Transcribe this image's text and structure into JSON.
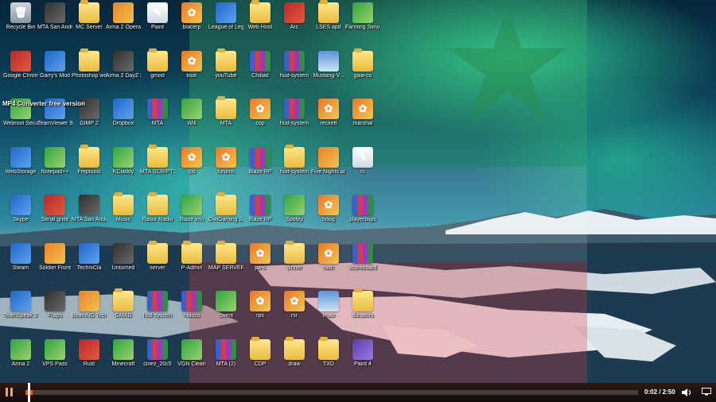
{
  "overlay_caption": "MP4 Converter free version",
  "player": {
    "time": "0:02 / 2:50",
    "progress": 0.012
  },
  "icons": [
    {
      "label": "Recycle Bin",
      "type": "bin",
      "col": 0,
      "row": 0
    },
    {
      "label": "MTA San Andreas 1.3",
      "type": "game",
      "col": 1,
      "row": 0
    },
    {
      "label": "MC Server",
      "type": "folder",
      "col": 2,
      "row": 0
    },
    {
      "label": "Arma 2 Operati...",
      "type": "orange",
      "col": 3,
      "row": 0
    },
    {
      "label": "Paint",
      "type": "doc",
      "col": 4,
      "row": 0
    },
    {
      "label": "blacerp",
      "type": "img",
      "col": 5,
      "row": 0
    },
    {
      "label": "League of Legends",
      "type": "blue",
      "col": 6,
      "row": 0
    },
    {
      "label": "Web Host",
      "type": "folder",
      "col": 7,
      "row": 0
    },
    {
      "label": "Arc",
      "type": "red",
      "col": 8,
      "row": 0
    },
    {
      "label": "LSES apd",
      "type": "folder",
      "col": 9,
      "row": 0
    },
    {
      "label": "Farming Simulator 15",
      "type": "green",
      "col": 10,
      "row": 0
    },
    {
      "label": "Google Chrome",
      "type": "red",
      "col": 0,
      "row": 1
    },
    {
      "label": "Garry's Mod",
      "type": "blue",
      "col": 1,
      "row": 1
    },
    {
      "label": "Photoshop work",
      "type": "folder",
      "col": 2,
      "row": 1
    },
    {
      "label": "Arma 2 DayZ Mod",
      "type": "game",
      "col": 3,
      "row": 1
    },
    {
      "label": "gmod",
      "type": "folder",
      "col": 4,
      "row": 1
    },
    {
      "label": "ksor",
      "type": "img",
      "col": 5,
      "row": 1
    },
    {
      "label": "youTube",
      "type": "folder",
      "col": 6,
      "row": 1
    },
    {
      "label": "Chillad",
      "type": "rar",
      "col": 7,
      "row": 1
    },
    {
      "label": "hud-system",
      "type": "rar",
      "col": 8,
      "row": 1
    },
    {
      "label": "Mustang-V...",
      "type": "photo",
      "col": 9,
      "row": 1
    },
    {
      "label": "gaia-co",
      "type": "folder",
      "col": 10,
      "row": 1
    },
    {
      "label": "Webroot SecureAny...",
      "type": "green",
      "col": 0,
      "row": 2
    },
    {
      "label": "TeamViewer 9",
      "type": "blue",
      "col": 1,
      "row": 2
    },
    {
      "label": "GIMP 2",
      "type": "game",
      "col": 2,
      "row": 2
    },
    {
      "label": "Dropbox",
      "type": "blue",
      "col": 3,
      "row": 2
    },
    {
      "label": "MTA",
      "type": "rar",
      "col": 4,
      "row": 2
    },
    {
      "label": "Will",
      "type": "green",
      "col": 5,
      "row": 2
    },
    {
      "label": "MTA",
      "type": "folder",
      "col": 6,
      "row": 2
    },
    {
      "label": "cop",
      "type": "img",
      "col": 7,
      "row": 2
    },
    {
      "label": "hud-system",
      "type": "rar",
      "col": 8,
      "row": 2
    },
    {
      "label": "reckett",
      "type": "img",
      "col": 9,
      "row": 2
    },
    {
      "label": "marshal",
      "type": "img",
      "col": 10,
      "row": 2
    },
    {
      "label": "WebStorage",
      "type": "blue",
      "col": 0,
      "row": 3
    },
    {
      "label": "Notepad++",
      "type": "green",
      "col": 1,
      "row": 3
    },
    {
      "label": "Freptools",
      "type": "folder",
      "col": 2,
      "row": 3
    },
    {
      "label": "KCladdy",
      "type": "green",
      "col": 3,
      "row": 3
    },
    {
      "label": "MTA SCRIPTS",
      "type": "folder",
      "col": 4,
      "row": 3
    },
    {
      "label": "fpd",
      "type": "img",
      "col": 5,
      "row": 3
    },
    {
      "label": "forums",
      "type": "img",
      "col": 6,
      "row": 3
    },
    {
      "label": "Blaze RP",
      "type": "rar",
      "col": 7,
      "row": 3
    },
    {
      "label": "hud-system",
      "type": "folder",
      "col": 8,
      "row": 3
    },
    {
      "label": "Five Nights at Freddy's",
      "type": "orange",
      "col": 9,
      "row": 3
    },
    {
      "label": "rc",
      "type": "doc",
      "col": 10,
      "row": 3
    },
    {
      "label": "Skype",
      "type": "blue",
      "col": 0,
      "row": 4
    },
    {
      "label": "Serial gnite",
      "type": "red",
      "col": 1,
      "row": 4
    },
    {
      "label": "MTA San Andreas 1.4",
      "type": "game",
      "col": 2,
      "row": 4
    },
    {
      "label": "Music",
      "type": "folder",
      "col": 3,
      "row": 4
    },
    {
      "label": "Rasor Radio",
      "type": "folder",
      "col": 4,
      "row": 4
    },
    {
      "label": "Blaze info",
      "type": "green",
      "col": 5,
      "row": 4
    },
    {
      "label": "OwlGaming Scripts",
      "type": "folder",
      "col": 6,
      "row": 4
    },
    {
      "label": "Blaze RP",
      "type": "rar",
      "col": 7,
      "row": 4
    },
    {
      "label": "Spotify",
      "type": "green",
      "col": 8,
      "row": 4
    },
    {
      "label": "hdog",
      "type": "img",
      "col": 9,
      "row": 4
    },
    {
      "label": "playerblips",
      "type": "rar",
      "col": 10,
      "row": 4
    },
    {
      "label": "Steam",
      "type": "blue",
      "col": 0,
      "row": 5
    },
    {
      "label": "Soldier Front",
      "type": "orange",
      "col": 1,
      "row": 5
    },
    {
      "label": "TechniCla",
      "type": "blue",
      "col": 2,
      "row": 5
    },
    {
      "label": "Unturned",
      "type": "game",
      "col": 3,
      "row": 5
    },
    {
      "label": "server",
      "type": "folder",
      "col": 4,
      "row": 5
    },
    {
      "label": "P-Admin",
      "type": "folder",
      "col": 5,
      "row": 5
    },
    {
      "label": "MAP SERVER",
      "type": "folder",
      "col": 6,
      "row": 5
    },
    {
      "label": "pa-s",
      "type": "img",
      "col": 7,
      "row": 5
    },
    {
      "label": "dinner",
      "type": "folder",
      "col": 8,
      "row": 5
    },
    {
      "label": "rash",
      "type": "img",
      "col": 9,
      "row": 5
    },
    {
      "label": "scoreboard",
      "type": "rar",
      "col": 10,
      "row": 5
    },
    {
      "label": "TeamSpeak 3 Client",
      "type": "blue",
      "col": 0,
      "row": 6
    },
    {
      "label": "Fraps",
      "type": "game",
      "col": 1,
      "row": 6
    },
    {
      "label": "BeamNG Techdemo",
      "type": "orange",
      "col": 2,
      "row": 6
    },
    {
      "label": "GMAD",
      "type": "folder",
      "col": 3,
      "row": 6
    },
    {
      "label": "hud-system",
      "type": "rar",
      "col": 4,
      "row": 6
    },
    {
      "label": "htdocs",
      "type": "rar",
      "col": 5,
      "row": 6
    },
    {
      "label": "cwent",
      "type": "green",
      "col": 6,
      "row": 6
    },
    {
      "label": "rps",
      "type": "img",
      "col": 7,
      "row": 6
    },
    {
      "label": "rsr",
      "type": "img",
      "col": 8,
      "row": 6
    },
    {
      "label": "Imao",
      "type": "photo",
      "col": 9,
      "row": 6
    },
    {
      "label": "donators",
      "type": "folder",
      "col": 10,
      "row": 6
    },
    {
      "label": "Arma 2",
      "type": "green",
      "col": 0,
      "row": 7
    },
    {
      "label": "VPS Pass",
      "type": "green",
      "col": 1,
      "row": 7
    },
    {
      "label": "Rust",
      "type": "red",
      "col": 2,
      "row": 7
    },
    {
      "label": "Minecraft",
      "type": "green",
      "col": 3,
      "row": 7
    },
    {
      "label": "cinez_20c5",
      "type": "rar",
      "col": 4,
      "row": 7
    },
    {
      "label": "VGN Clean",
      "type": "green",
      "col": 5,
      "row": 7
    },
    {
      "label": "MTA (2)",
      "type": "rar",
      "col": 6,
      "row": 7
    },
    {
      "label": "CDP",
      "type": "folder",
      "col": 7,
      "row": 7
    },
    {
      "label": "draw",
      "type": "folder",
      "col": 8,
      "row": 7
    },
    {
      "label": "TXD",
      "type": "folder",
      "col": 9,
      "row": 7
    },
    {
      "label": "Paint 4",
      "type": "purple",
      "col": 10,
      "row": 7
    }
  ],
  "type_glyphs": {
    "bin": "🗑",
    "game": "",
    "folder": "",
    "orange": "",
    "doc": "✎",
    "img": "✿",
    "blue": "",
    "red": "",
    "green": "",
    "rar": "",
    "photo": "",
    "purple": ""
  }
}
